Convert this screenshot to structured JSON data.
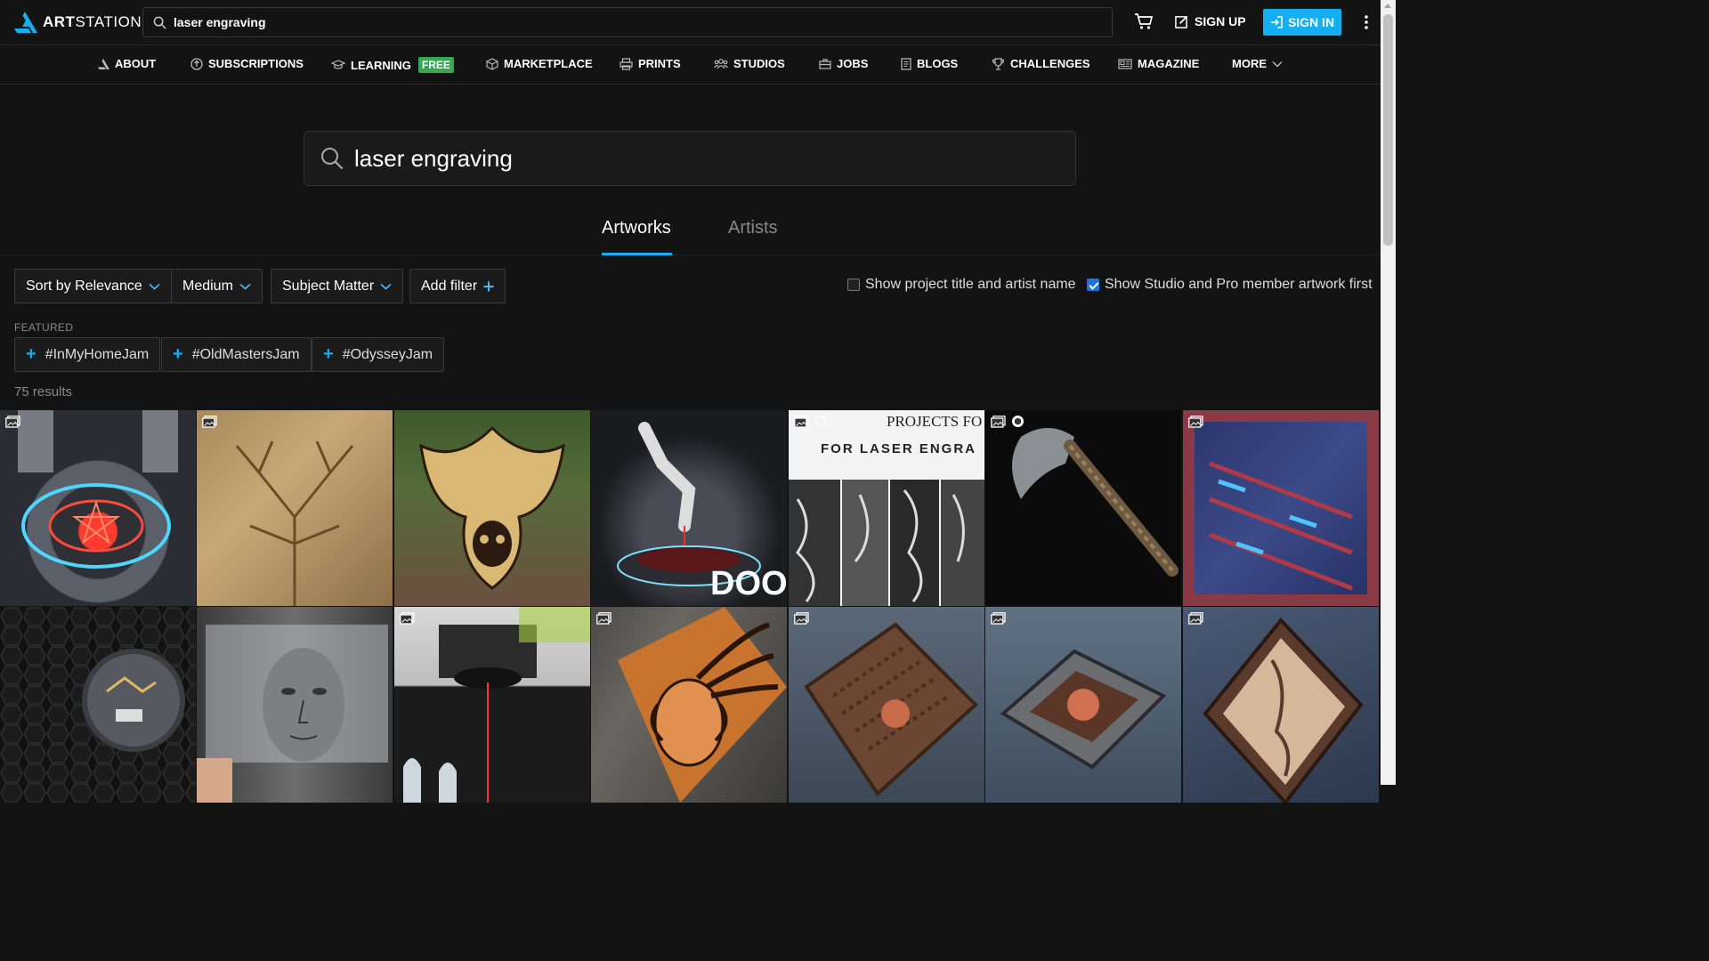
{
  "brand": {
    "name_bold": "ART",
    "name_rest": "STATION"
  },
  "top_search": {
    "value": "laser engraving"
  },
  "header": {
    "signup_label": "SIGN UP",
    "signin_label": "SIGN IN"
  },
  "nav": {
    "about": "ABOUT",
    "subscriptions": "SUBSCRIPTIONS",
    "learning": "LEARNING",
    "learning_badge": "FREE",
    "marketplace": "MARKETPLACE",
    "prints": "PRINTS",
    "studios": "STUDIOS",
    "jobs": "JOBS",
    "blogs": "BLOGS",
    "challenges": "CHALLENGES",
    "magazine": "MAGAZINE",
    "more": "MORE"
  },
  "main_search": {
    "value": "laser engraving"
  },
  "tabs": {
    "artworks": "Artworks",
    "artists": "Artists"
  },
  "filters": {
    "sort": "Sort by Relevance",
    "medium": "Medium",
    "subject": "Subject Matter",
    "add": "Add filter",
    "show_title": {
      "label": "Show project title and artist name",
      "checked": false
    },
    "show_pro": {
      "label": "Show Studio and Pro member artwork first",
      "checked": true
    }
  },
  "featured": {
    "label": "FEATURED",
    "chips": [
      "#InMyHomeJam",
      "#OldMastersJam",
      "#OdysseyJam"
    ]
  },
  "results": {
    "count_text": "75 results"
  },
  "artworks": {
    "tile5_text": {
      "line1": "PROJECTS FO",
      "line2": "FOR   LASER ENGRA"
    },
    "tile4_text": "DOOM"
  },
  "colors": {
    "accent": "#13aff0",
    "background": "#131313",
    "free_badge": "#34a853"
  }
}
